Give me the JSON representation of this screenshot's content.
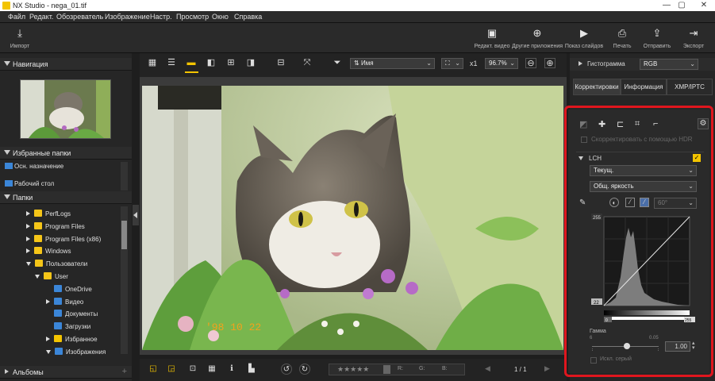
{
  "window": {
    "title": "NX Studio - nega_01.tif"
  },
  "menu": [
    "Файл",
    "Редакт.",
    "Обозреватель",
    "Изображение",
    "Настр.",
    "Просмотр",
    "Окно",
    "Справка"
  ],
  "toolbar": {
    "import": "Импорт",
    "edit_video": "Редакт. видео",
    "other_apps": "Другие приложения",
    "slideshow": "Показ слайдов",
    "print": "Печать",
    "send": "Отправить",
    "export": "Экспорт"
  },
  "left": {
    "nav_title": "Навигация",
    "fav_title": "Избранные папки",
    "fav_items": [
      "Осн. назначение",
      "Рабочий стол"
    ],
    "folders_title": "Папки",
    "folders": [
      {
        "label": "PerfLogs",
        "level": 1,
        "state": "collapsed"
      },
      {
        "label": "Program Files",
        "level": 1,
        "state": "collapsed"
      },
      {
        "label": "Program Files (x86)",
        "level": 1,
        "state": "collapsed"
      },
      {
        "label": "Windows",
        "level": 1,
        "state": "collapsed"
      },
      {
        "label": "Пользователи",
        "level": 1,
        "state": "expanded"
      },
      {
        "label": "User",
        "level": 2,
        "state": "expanded"
      },
      {
        "label": "OneDrive",
        "level": 3,
        "state": "none"
      },
      {
        "label": "Видео",
        "level": 3,
        "state": "collapsed"
      },
      {
        "label": "Документы",
        "level": 3,
        "state": "none"
      },
      {
        "label": "Загрузки",
        "level": 3,
        "state": "none"
      },
      {
        "label": "Избранное",
        "level": 3,
        "state": "collapsed"
      },
      {
        "label": "Изображения",
        "level": 3,
        "state": "expanded"
      }
    ],
    "albums_title": "Альбомы"
  },
  "viewer": {
    "sort_label": "Имя",
    "zoom_x": "x1",
    "zoom_pct": "96.7%",
    "page": "1 / 1",
    "photo_text": "'98 10 22",
    "rgb_labels": [
      "R:",
      "G:",
      "B:"
    ]
  },
  "right": {
    "histogram_title": "Гистограмма",
    "histogram_channel": "RGB",
    "tabs": [
      "Корректировки",
      "Информация",
      "XMP/IPTC"
    ],
    "hdr_label": "Скорректировать с помощью HDR",
    "lch_title": "LCH",
    "dropdown1": "Текущ.",
    "dropdown2": "Общ. яркость",
    "angle_value": "60°",
    "curve_max": "255",
    "curve_min": "22",
    "range_left": "0",
    "range_right": "255",
    "gamma_title": "Гамма",
    "gamma_min": "6",
    "gamma_max": "0.05",
    "gamma_value": "1.00",
    "gray_label": "Искл. серый"
  },
  "colors": {
    "accent": "#f3c400",
    "highlight_border": "#e0161e",
    "background": "#1e1e1e"
  },
  "icons": [
    "import-icon",
    "edit-video-icon",
    "other-apps-icon",
    "slideshow-icon",
    "print-icon",
    "send-icon",
    "export-icon",
    "filter-icon",
    "zoom-out-icon",
    "zoom-in-icon",
    "gear-icon",
    "rotate-left-icon",
    "rotate-right-icon"
  ]
}
